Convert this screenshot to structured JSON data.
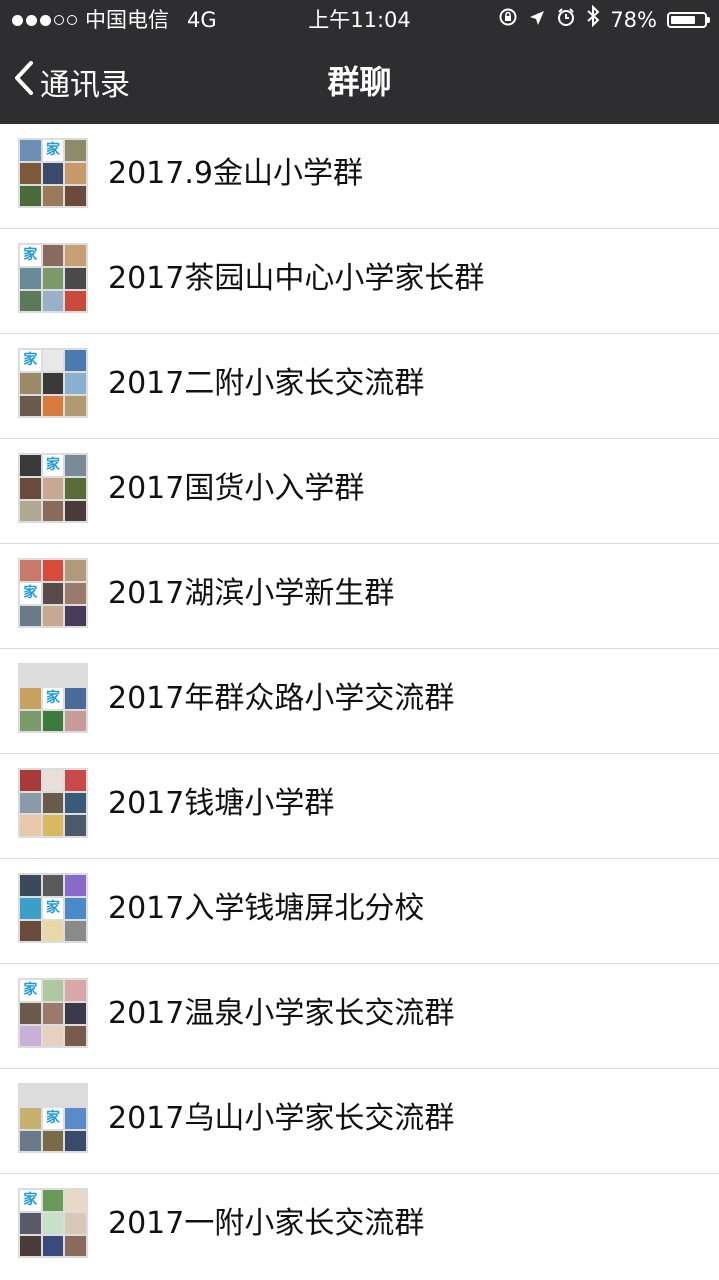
{
  "status_bar": {
    "carrier": "中国电信",
    "network": "4G",
    "time": "上午11:04",
    "battery_percent_text": "78%",
    "battery_level": 0.78,
    "signal_strength": 3,
    "signal_max": 5
  },
  "nav": {
    "back_label": "通讯录",
    "title": "群聊"
  },
  "avatar_glyph": "家",
  "groups": [
    {
      "name": "2017.9金山小学群",
      "tiles": [
        "#6a8fb5",
        "jia",
        "#8c8c6a",
        "#7a5a3a",
        "#3a4a6a",
        "#c89a6a",
        "#4a6a3a",
        "#9a7a5a",
        "#6a4a3a"
      ]
    },
    {
      "name": "2017茶园山中心小学家长群",
      "tiles": [
        "jia",
        "#8a6a5a",
        "#c8a070",
        "#6a8a9a",
        "#7a9a6a",
        "#4a4a4a",
        "#5a7a5a",
        "#9ab0c8",
        "#c84a3a"
      ]
    },
    {
      "name": "2017二附小家长交流群",
      "tiles": [
        "jia",
        "#e8e8e8",
        "#4a7ab0",
        "#9a8a6a",
        "#3a3a3a",
        "#8ab0d0",
        "#6a5a4a",
        "#d87a3a",
        "#b09a70"
      ]
    },
    {
      "name": "2017国货小入学群",
      "tiles": [
        "#3a3a3a",
        "jia",
        "#7a8a9a",
        "#6a4a3a",
        "#c8a890",
        "#5a6a3a",
        "#b0a890",
        "#8a6a5a",
        "#4a3a3a"
      ]
    },
    {
      "name": "2017湖滨小学新生群",
      "tiles": [
        "#c87a6a",
        "#d84a3a",
        "#b09a7a",
        "jia",
        "#5a4a4a",
        "#9a7a6a",
        "#6a7a8a",
        "#c8a890",
        "#4a3a5a"
      ]
    },
    {
      "name": "2017年群众路小学交流群",
      "tiles": [
        "empty",
        "empty",
        "empty",
        "#c8a060",
        "jia",
        "#4a6a9a",
        "#7a9a6a",
        "#3a7a3a",
        "#c89a9a"
      ]
    },
    {
      "name": "2017钱塘小学群",
      "tiles": [
        "#a83a3a",
        "#e8e0d8",
        "#c84a4a",
        "#8a9aa8",
        "#6a5a4a",
        "#3a5a7a",
        "#e8c8a8",
        "#d8b860",
        "#4a5a6a"
      ]
    },
    {
      "name": "2017入学钱塘屏北分校",
      "tiles": [
        "#3a4a5a",
        "#5a5a5a",
        "#8a6ac8",
        "#3aa0c8",
        "jia",
        "#4a8ac8",
        "#6a4a3a",
        "#e8d8a8",
        "#8a8a8a"
      ]
    },
    {
      "name": "2017温泉小学家长交流群",
      "tiles": [
        "jia",
        "#b0c8a0",
        "#d8a8a8",
        "#6a5a4a",
        "#9a7a6a",
        "#3a3a4a",
        "#c8b0d8",
        "#e8d0c0",
        "#7a5a4a"
      ]
    },
    {
      "name": "2017乌山小学家长交流群",
      "tiles": [
        "empty",
        "empty",
        "empty",
        "#c8b070",
        "jia",
        "#5a8ac8",
        "#6a7a8a",
        "#7a6a4a",
        "#3a4a6a"
      ]
    },
    {
      "name": "2017一附小家长交流群",
      "tiles": [
        "jia",
        "#6a9a5a",
        "#e8d8c8",
        "#5a5a6a",
        "#c8e0c8",
        "#d8c8b8",
        "#4a3a3a",
        "#3a4a7a",
        "#8a6a5a"
      ]
    }
  ]
}
